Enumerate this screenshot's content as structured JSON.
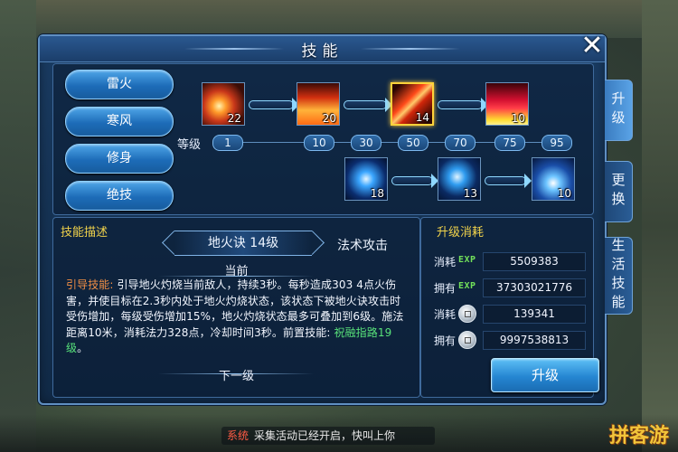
{
  "window": {
    "title": "技能",
    "close": "✕"
  },
  "categories": [
    "雷火",
    "寒风",
    "修身",
    "绝技"
  ],
  "skill_tree": {
    "level_label": "等级",
    "levels": [
      "1",
      "10",
      "30",
      "50",
      "70",
      "75",
      "95"
    ],
    "fire_row": [
      {
        "level": "22",
        "style": "fire1"
      },
      {
        "level": "20",
        "style": "fire2"
      },
      {
        "level": "14",
        "style": "fire3",
        "selected": true
      },
      {
        "level": "10",
        "style": "fire4"
      }
    ],
    "thunder_row": [
      {
        "level": "18",
        "style": "bolt1"
      },
      {
        "level": "13",
        "style": "bolt2"
      },
      {
        "level": "10",
        "style": "bolt3"
      }
    ]
  },
  "description": {
    "header": "技能描述",
    "skill_name": "地火诀 14级",
    "skill_type": "法术攻击",
    "current_label": "当前",
    "next_label": "下一级",
    "lead": "引导技能:",
    "body": " 引导地火灼烧当前敌人，持续3秒。每秒造成303 4点火伤害，并使目标在2.3秒内处于地火灼烧状态，该状态下被地火诀攻击时受伤增加，每级受伤增加15%，地火灼烧状态最多可叠加到6级。施法距离10米，消耗法力328点，冷却时间3秒。前置技能: ",
    "prereq": "祝融指路19级",
    "tail": "。"
  },
  "upgrade_cost": {
    "header": "升级消耗",
    "rows": [
      {
        "label": "消耗",
        "icon": "EXP",
        "value": "5509383"
      },
      {
        "label": "拥有",
        "icon": "EXP",
        "value": "37303021776"
      },
      {
        "label": "消耗",
        "icon": "coin",
        "value": "139341"
      },
      {
        "label": "拥有",
        "icon": "coin",
        "value": "9997538813"
      }
    ],
    "button": "升级"
  },
  "side_tabs": [
    "升级",
    "更换",
    "生活技能"
  ],
  "background": {
    "news_tag": "系统",
    "news_text": "采集活动已经开启，快叫上你",
    "watermark": "拼客游"
  }
}
